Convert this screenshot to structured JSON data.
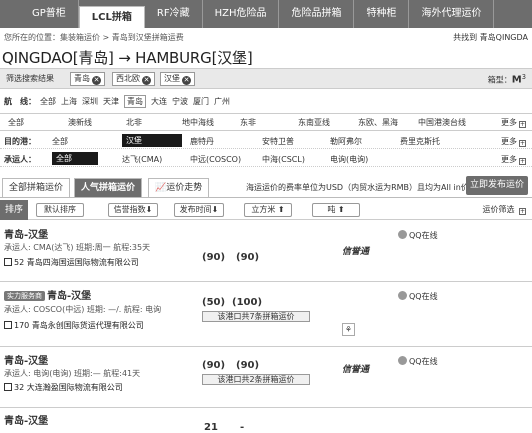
{
  "nav": {
    "items": [
      "GP普柜",
      "LCL拼箱",
      "RF冷藏",
      "HZH危险品",
      "危险品拼箱",
      "特种柜",
      "海外代理运价"
    ],
    "active": 1
  },
  "breadcrumb": {
    "prefix": "您所在的位置：",
    "level1": "集装箱运价",
    "sep": ">",
    "level2": "青岛到汉堡拼箱运费"
  },
  "found": "共找到 青岛QINGDA",
  "route": "QINGDAO[青岛] → HAMBURG[汉堡]",
  "filter": {
    "label": "筛选搜索结果",
    "tags": [
      "青岛",
      "西北欧",
      "汉堡"
    ],
    "box_type_label": "箱型：",
    "box_type_value": "M",
    "box_type_sup": "3"
  },
  "airline": {
    "label": "航　线：",
    "items": [
      "全部",
      "上海",
      "深圳",
      "天津",
      "青岛",
      "大连",
      "宁波",
      "厦门",
      "广州"
    ],
    "selected": "青岛"
  },
  "lines": {
    "items": [
      "全部",
      "澳新线",
      "北非",
      "地中海线",
      "东非",
      "东南亚线",
      "东欧、黑海",
      "中国港澳台线"
    ],
    "more": "更多"
  },
  "dest": {
    "label": "目的港：",
    "items": [
      "全部",
      "汉堡",
      "鹿特丹",
      "安特卫普",
      "勒阿弗尔",
      "费里克斯托"
    ],
    "selected": "汉堡",
    "more": "更多"
  },
  "carrier": {
    "label": "承运人：",
    "items": [
      "全部",
      "达飞(CMA)",
      "中远(COSCO)",
      "中海(CSCL)",
      "电询(电询)"
    ],
    "selected": "全部",
    "more": "更多"
  },
  "tabs": {
    "all": "全部拼箱运价",
    "hot": "人气拼箱运价",
    "trend": "运价走势",
    "note": "海运运价的费率单位为USD（内贸水运为RMB）且均为All in价",
    "publish": "立即发布运价"
  },
  "sort": {
    "label": "排序",
    "default": "默认排序",
    "credit": "信誉指数",
    "time": "发布时间",
    "cbm": "立方米",
    "ton": "吨",
    "filter": "运价筛选"
  },
  "listings": [
    {
      "title": "青岛-汉堡",
      "badge": "",
      "info": "承运人: CMA(达飞) 班期:周一 航程:35天",
      "company": "52 青岛四海国运国际物流有限公司",
      "price1": "(90)",
      "price2": "(90)",
      "note": "",
      "credit": "信誉通",
      "qq": "QQ在线"
    },
    {
      "title": "青岛-汉堡",
      "badge": "实力服务商",
      "info": "承运人: COSCO(中远) 班期: —/. 航程: 电询",
      "company": "170 青岛永创国际货运代理有限公司",
      "price1": "(50)",
      "price2": "(100)",
      "note": "该港口共7条拼箱运价",
      "credit": "",
      "qq": "QQ在线"
    },
    {
      "title": "青岛-汉堡",
      "badge": "",
      "info": "承运人: 电询(电询) 班期:— 航程:41天",
      "company": "32 大连瀚盈国际物流有限公司",
      "price1": "(90)",
      "price2": "(90)",
      "note": "该港口共2条拼箱运价",
      "credit": "信誉通",
      "qq": "QQ在线"
    },
    {
      "title": "青岛-汉堡",
      "badge": "",
      "info": "",
      "company": "",
      "price1": "21",
      "price2": "-",
      "note": "",
      "credit": "",
      "qq": ""
    }
  ]
}
